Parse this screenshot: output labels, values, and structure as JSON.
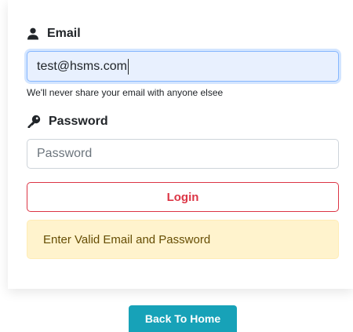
{
  "form": {
    "email_label": "Email",
    "email_value": "test@hsms.com",
    "email_help": "We'll never share your email with anyone elsee",
    "password_label": "Password",
    "password_placeholder": "Password",
    "login_label": "Login"
  },
  "alert": {
    "message": "Enter Valid Email and Password"
  },
  "footer": {
    "home_label": "Back To Home"
  },
  "icons": {
    "email": "user-icon",
    "password": "key-icon"
  },
  "colors": {
    "danger": "#dc3545",
    "warning_bg": "#fff3cd",
    "warning_text": "#664d03",
    "info": "#17a2b8",
    "autofill_bg": "#e8f0fe"
  }
}
